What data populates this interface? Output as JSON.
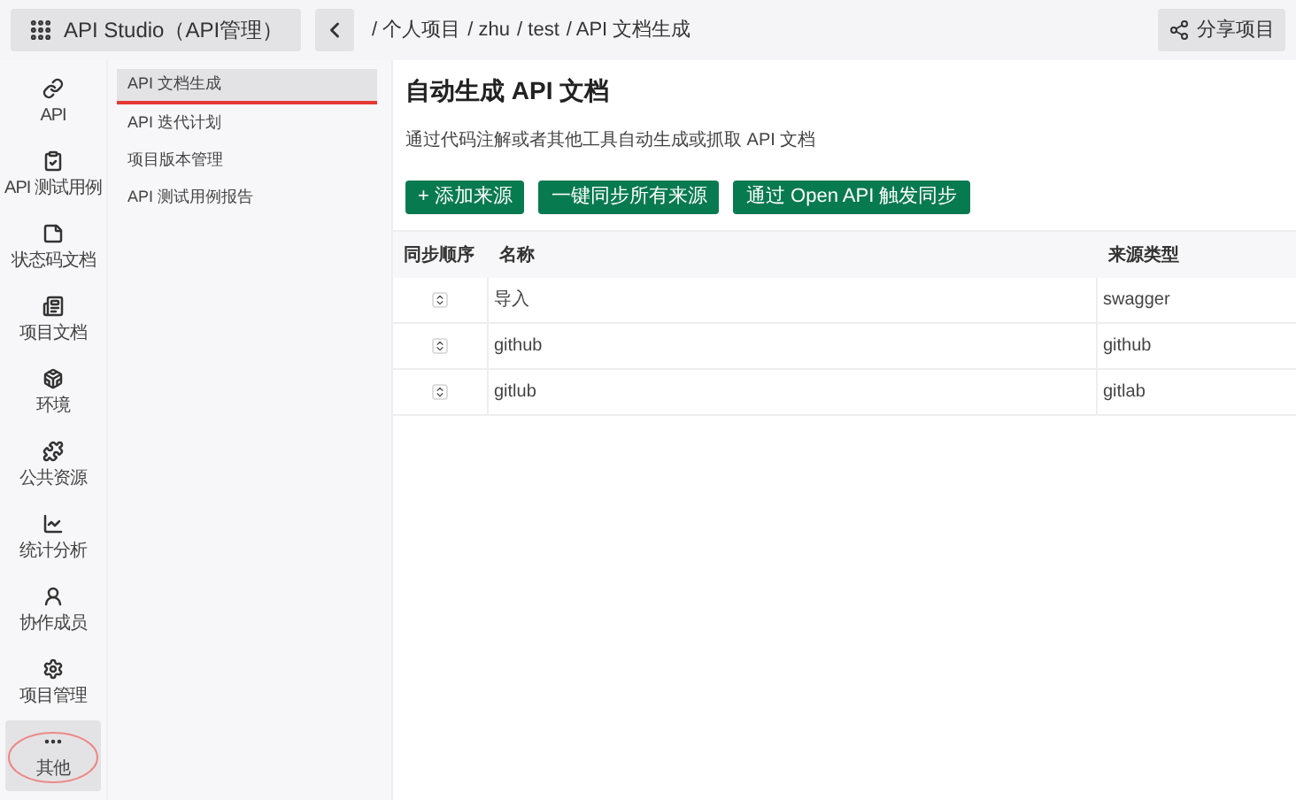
{
  "header": {
    "app_title": "API Studio（API管理）",
    "breadcrumb": [
      "/ 个人项目",
      "/ zhu",
      "/ test",
      "/ API 文档生成"
    ],
    "share_button": "分享项目"
  },
  "rail": [
    {
      "label": "API",
      "selected": false
    },
    {
      "label": "API 测试用例",
      "selected": false
    },
    {
      "label": "状态码文档",
      "selected": false
    },
    {
      "label": "项目文档",
      "selected": false
    },
    {
      "label": "环境",
      "selected": false
    },
    {
      "label": "公共资源",
      "selected": false
    },
    {
      "label": "统计分析",
      "selected": false
    },
    {
      "label": "协作成员",
      "selected": false
    },
    {
      "label": "项目管理",
      "selected": false
    },
    {
      "label": "其他",
      "selected": true
    }
  ],
  "submenu": [
    {
      "label": "API 文档生成",
      "selected": true
    },
    {
      "label": "API 迭代计划",
      "selected": false
    },
    {
      "label": "项目版本管理",
      "selected": false
    },
    {
      "label": "API 测试用例报告",
      "selected": false
    }
  ],
  "main": {
    "title": "自动生成 API 文档",
    "description": "通过代码注解或者其他工具自动生成或抓取 API 文档",
    "buttons": [
      "+ 添加来源",
      "一键同步所有来源",
      "通过 Open API 触发同步"
    ],
    "table": {
      "columns": [
        "同步顺序",
        "名称",
        "来源类型"
      ],
      "rows": [
        {
          "name": "导入",
          "type": "swagger"
        },
        {
          "name": "github",
          "type": "github"
        },
        {
          "name": "gitlub",
          "type": "gitlab"
        }
      ]
    }
  }
}
